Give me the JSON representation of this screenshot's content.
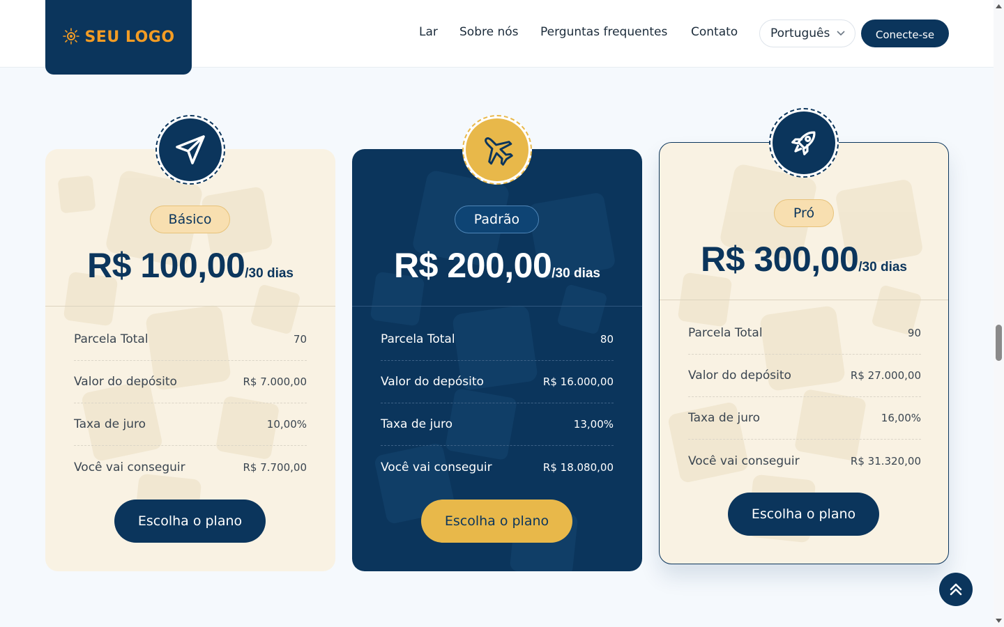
{
  "header": {
    "logo_text": "SEU LOGO",
    "nav": [
      "Lar",
      "Sobre nós",
      "Perguntas frequentes",
      "Contato"
    ],
    "language": "Português",
    "login_label": "Conecte-se"
  },
  "plans": [
    {
      "badge": "Básico",
      "price": "R$ 100,00",
      "period": "/30 dias",
      "icon": "paper-plane-icon",
      "rows": [
        {
          "label": "Parcela Total",
          "value": "70"
        },
        {
          "label": "Valor do depósito",
          "value": "R$ 7.000,00"
        },
        {
          "label": "Taxa de juro",
          "value": "10,00%"
        },
        {
          "label": "Você vai conseguir",
          "value": "R$ 7.700,00"
        }
      ],
      "cta": "Escolha o plano"
    },
    {
      "badge": "Padrão",
      "price": "R$ 200,00",
      "period": "/30 dias",
      "icon": "airplane-icon",
      "rows": [
        {
          "label": "Parcela Total",
          "value": "80"
        },
        {
          "label": "Valor do depósito",
          "value": "R$ 16.000,00"
        },
        {
          "label": "Taxa de juro",
          "value": "13,00%"
        },
        {
          "label": "Você vai conseguir",
          "value": "R$ 18.080,00"
        }
      ],
      "cta": "Escolha o plano"
    },
    {
      "badge": "Pró",
      "price": "R$ 300,00",
      "period": "/30 dias",
      "icon": "rocket-icon",
      "rows": [
        {
          "label": "Parcela Total",
          "value": "90"
        },
        {
          "label": "Valor do depósito",
          "value": "R$ 27.000,00"
        },
        {
          "label": "Taxa de juro",
          "value": "16,00%"
        },
        {
          "label": "Você vai conseguir",
          "value": "R$ 31.320,00"
        }
      ],
      "cta": "Escolha o plano"
    }
  ],
  "colors": {
    "navy": "#0b355c",
    "gold": "#e8b84a",
    "cream": "#f9f2e3",
    "logo_orange": "#f39c24"
  }
}
